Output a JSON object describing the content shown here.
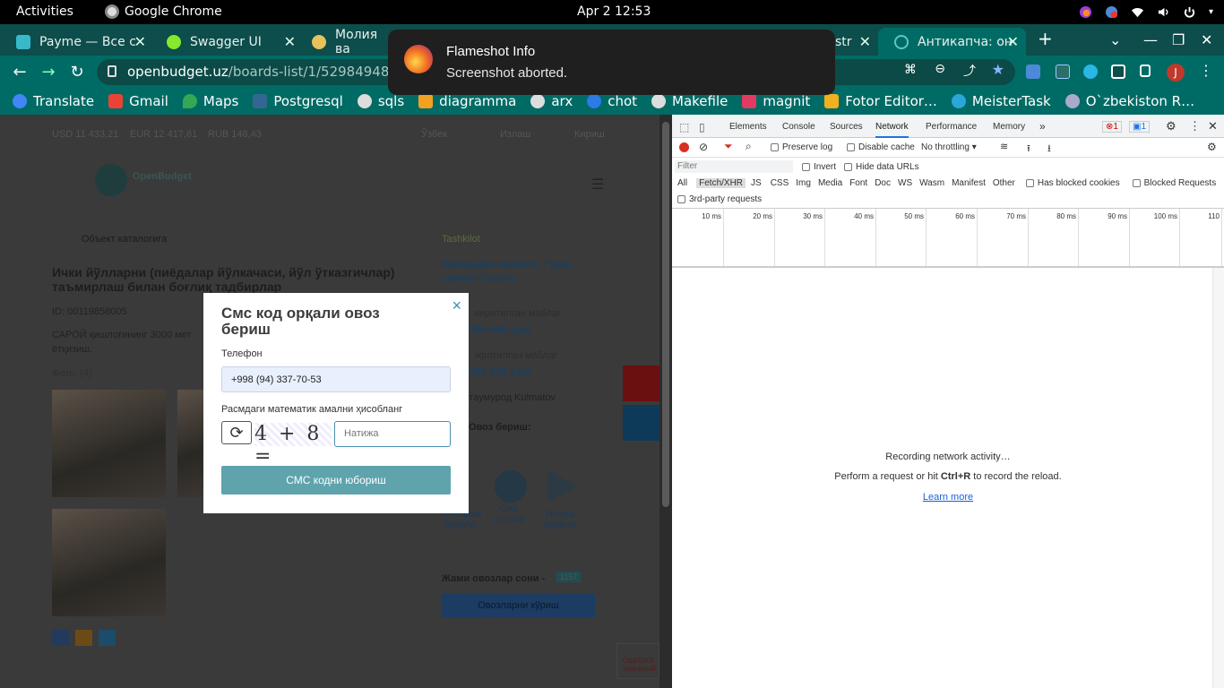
{
  "system": {
    "activities": "Activities",
    "app_name": "Google Chrome",
    "clock": "Apr 2  12:53"
  },
  "tabs": [
    {
      "title": "Payme — Все с",
      "favicon_color": "#39b8c8"
    },
    {
      "title": "Swagger UI",
      "favicon_color": "#85ea2d"
    },
    {
      "title": "Молия ва",
      "favicon_color": "#e6c25a"
    },
    {
      "title": "str",
      "favicon_color": "#8fbfbf"
    },
    {
      "title": "Антикапча: он",
      "favicon_color": "#5cc6c2"
    }
  ],
  "omnibox": {
    "host": "openbudget.uz",
    "path": "/boards-list/1/52984948-43a3-4"
  },
  "bookmarks": [
    {
      "label": "Translate",
      "color": "#4285f4"
    },
    {
      "label": "Gmail",
      "color": "#ea4335"
    },
    {
      "label": "Maps",
      "color": "#34a853"
    },
    {
      "label": "Postgresql",
      "color": "#336791"
    },
    {
      "label": "sqls",
      "color": "#dddddd"
    },
    {
      "label": "diagramma",
      "color": "#f4a020"
    },
    {
      "label": "arx",
      "color": "#dddddd"
    },
    {
      "label": "chot",
      "color": "#2c7be5"
    },
    {
      "label": "Makefile",
      "color": "#dddddd"
    },
    {
      "label": "magnit",
      "color": "#e23b62"
    },
    {
      "label": "Fotor Editor…",
      "color": "#f2b01e"
    },
    {
      "label": "MeisterTask",
      "color": "#2aa7d8"
    },
    {
      "label": "O`zbekiston R…",
      "color": "#aac"
    }
  ],
  "page": {
    "currency_usd": "USD 11 433,21",
    "currency_eur": "EUR 12 417,61",
    "currency_rub": "RUB 148,43",
    "lang": "Ўзбек",
    "search": "Излаш",
    "login": "Кириш",
    "logo_text": "OpenBudget",
    "catalog_link": "Объект каталогига",
    "project_title": "Ички йўлларни (пиёдалар йўлкачаси, йўл ўтказгичлар) таъмирлаш билан боғлиқ тадбирлар",
    "project_id": "ID: 00119858005",
    "desc": "САРОЙ қишлоғининг 3000 мет",
    "desc2": "ётқизиш.",
    "photos_label": "Фото: (4)",
    "region_label": "Tashkilot",
    "region": "Қашқадарё вилояти, Ғузор тумани Совбоғ",
    "amount1_label": "киритилган маблағ",
    "amount1": "000 000 сўм",
    "amount2_label": "жратилган маблағ",
    "amount2": "000 000 сўм",
    "author": "тayмурод Kulmatov",
    "vote_label": "Овоз бериш:",
    "vote_tg": "Телеграм орқали",
    "vote_sms": "Смс орқали",
    "vote_app": "Илова орқали",
    "total_votes_label": "Жами овозлар сони -",
    "total_votes": "1157",
    "view_votes": "Овозларни кўриш",
    "error_text": "ОШИБКА неверный"
  },
  "modal": {
    "title": "Смс код орқали овоз бериш",
    "phone_label": "Телефон",
    "phone_value": "+998 (94) 337-70-53",
    "math_label": "Расмдаги математик амални ҳисобланг",
    "captcha": "4 + 8 =",
    "answer_placeholder": "Натижа",
    "send_button": "СМС кодни юбориш"
  },
  "toast": {
    "title": "Flameshot Info",
    "body": "Screenshot aborted."
  },
  "devtools": {
    "tabs": [
      "Elements",
      "Console",
      "Sources",
      "Network",
      "Performance",
      "Memory"
    ],
    "active_tab": "Network",
    "error_count": "1",
    "msg_count": "1",
    "preserve_log": "Preserve log",
    "disable_cache": "Disable cache",
    "throttling": "No throttling",
    "filter_placeholder": "Filter",
    "invert": "Invert",
    "hide_data_urls": "Hide data URLs",
    "types": [
      "All",
      "Fetch/XHR",
      "JS",
      "CSS",
      "Img",
      "Media",
      "Font",
      "Doc",
      "WS",
      "Wasm",
      "Manifest",
      "Other"
    ],
    "has_blocked_cookies": "Has blocked cookies",
    "blocked_requests": "Blocked Requests",
    "third_party": "3rd-party requests",
    "timeline_ticks": [
      "10 ms",
      "20 ms",
      "30 ms",
      "40 ms",
      "50 ms",
      "60 ms",
      "70 ms",
      "80 ms",
      "90 ms",
      "100 ms",
      "110"
    ],
    "recording": "Recording network activity…",
    "hint_pre": "Perform a request or hit ",
    "hint_key": "Ctrl+R",
    "hint_post": " to record the reload.",
    "learn_more": "Learn more"
  }
}
